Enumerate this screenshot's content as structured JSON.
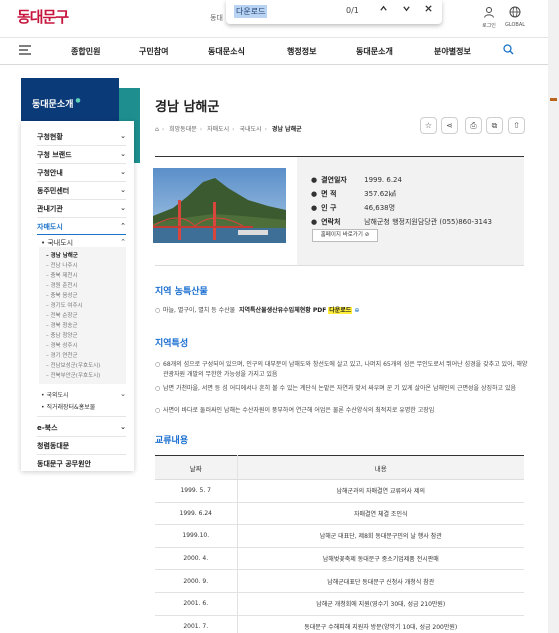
{
  "header": {
    "logo_text": "동대문구",
    "peek_text": "동대",
    "find": {
      "query": "다운로드",
      "count": "0/1",
      "prev_icon": "chevron-up",
      "next_icon": "chevron-down",
      "close_icon": "close"
    },
    "login_label": "로그인",
    "global_label": "GLOBAL"
  },
  "gnb": [
    "종합민원",
    "구민참여",
    "동대문소식",
    "행정정보",
    "동대문소개",
    "분야별정보"
  ],
  "sidebar": {
    "title": "동대문소개",
    "items": [
      {
        "label": "구청현황"
      },
      {
        "label": "구청 브랜드"
      },
      {
        "label": "구청안내"
      },
      {
        "label": "동주민센터"
      },
      {
        "label": "관내기관"
      },
      {
        "label": "자매도시"
      }
    ],
    "sub_domestic": "국내도시",
    "sub3": [
      "경남 남해군",
      "전남 나주시",
      "충북 제천시",
      "경원 춘천시",
      "충북 음성군",
      "경기도 여주시",
      "전북 순창군",
      "경북 청송군",
      "충남 청양군",
      "경북 성주시",
      "경기 연천군",
      "전남보성군(우호도시)",
      "전북부안군(우호도시)"
    ],
    "sub_overseas": "국외도시",
    "sub_connected": "직거래장터&홍보물",
    "bottom": [
      "e-북스",
      "청렴동대문",
      "동대문구 공무원안"
    ]
  },
  "content": {
    "title": "경남 남해군",
    "breadcrumb": [
      "희망동대문",
      "자매도시",
      "국내도시",
      "경남 남해군"
    ],
    "info": [
      {
        "key": "결연일자",
        "value": "1999. 6.24"
      },
      {
        "key": "면 적",
        "value": "357.62㎢"
      },
      {
        "key": "인 구",
        "value": "46,638명"
      },
      {
        "key": "연락처",
        "value": "남해군청 행정지원담당관 (055)860-3143"
      }
    ],
    "homepage_btn": "홈페이지 바로가기",
    "section1_title": "지역 농특산물",
    "section1_text": "마늘, 멸구이, 멸치 등 수산물",
    "section1_bold": "지역특산물생산유수입체현황 PDF",
    "section1_highlight": "다운로드",
    "section2_title": "지역특성",
    "features": [
      "68개의 섬으로 구성되어 있으며, 인구의 대부분이 남해도와 창선도에 살고 있고, 나머지 65개의 섬은 무인도로서 뛰어난 섬경을 갖추고 있어, 해양 관광자원 개발의 무한한 가능성을 가지고 있음",
      "남면 가천마을, 서면 등 섬 어디에서나 흔히 볼 수 있는 계단식 논밭은 자연과 맞서 싸우며 꾼 기 있게 살아온 남해인의 근면성을 상징하고 있음",
      "사면이 바다로 둘러싸인 남해는 수산자원이 풍부하여 연근해 어업은 물론 수산양식의 최적지로 유명한 고장임"
    ],
    "section3_title": "교류내용",
    "table_headers": [
      "날짜",
      "내용"
    ],
    "table_rows": [
      [
        "1999. 5. 7",
        "남해군과의 자매결연 교류의사 제의"
      ],
      [
        "1999. 6.24",
        "자매결연 체결 조인식"
      ],
      [
        "1999.10.",
        "남해군 대표단, 제8회 동대문구민의 날 행사 참관"
      ],
      [
        "2000. 4.",
        "남해벚꽃축제 동대문구 중소기업제품 전시판매"
      ],
      [
        "2000. 9.",
        "남해군대표단 동대문구 신청사 개청식 참관"
      ],
      [
        "2001. 6.",
        "남해군 개청회에 지원(영수기 30대, 성금 210만원)"
      ],
      [
        "2001. 7.",
        "동대문구 수해피해 지원자 방문(양악기 10대, 성금 200만원)"
      ]
    ]
  },
  "colors": {
    "brand_red": "#c7163e",
    "navy": "#0b3a78",
    "teal": "#1e8f8e",
    "link_blue": "#1a73c9",
    "highlight": "#ffef3a"
  }
}
